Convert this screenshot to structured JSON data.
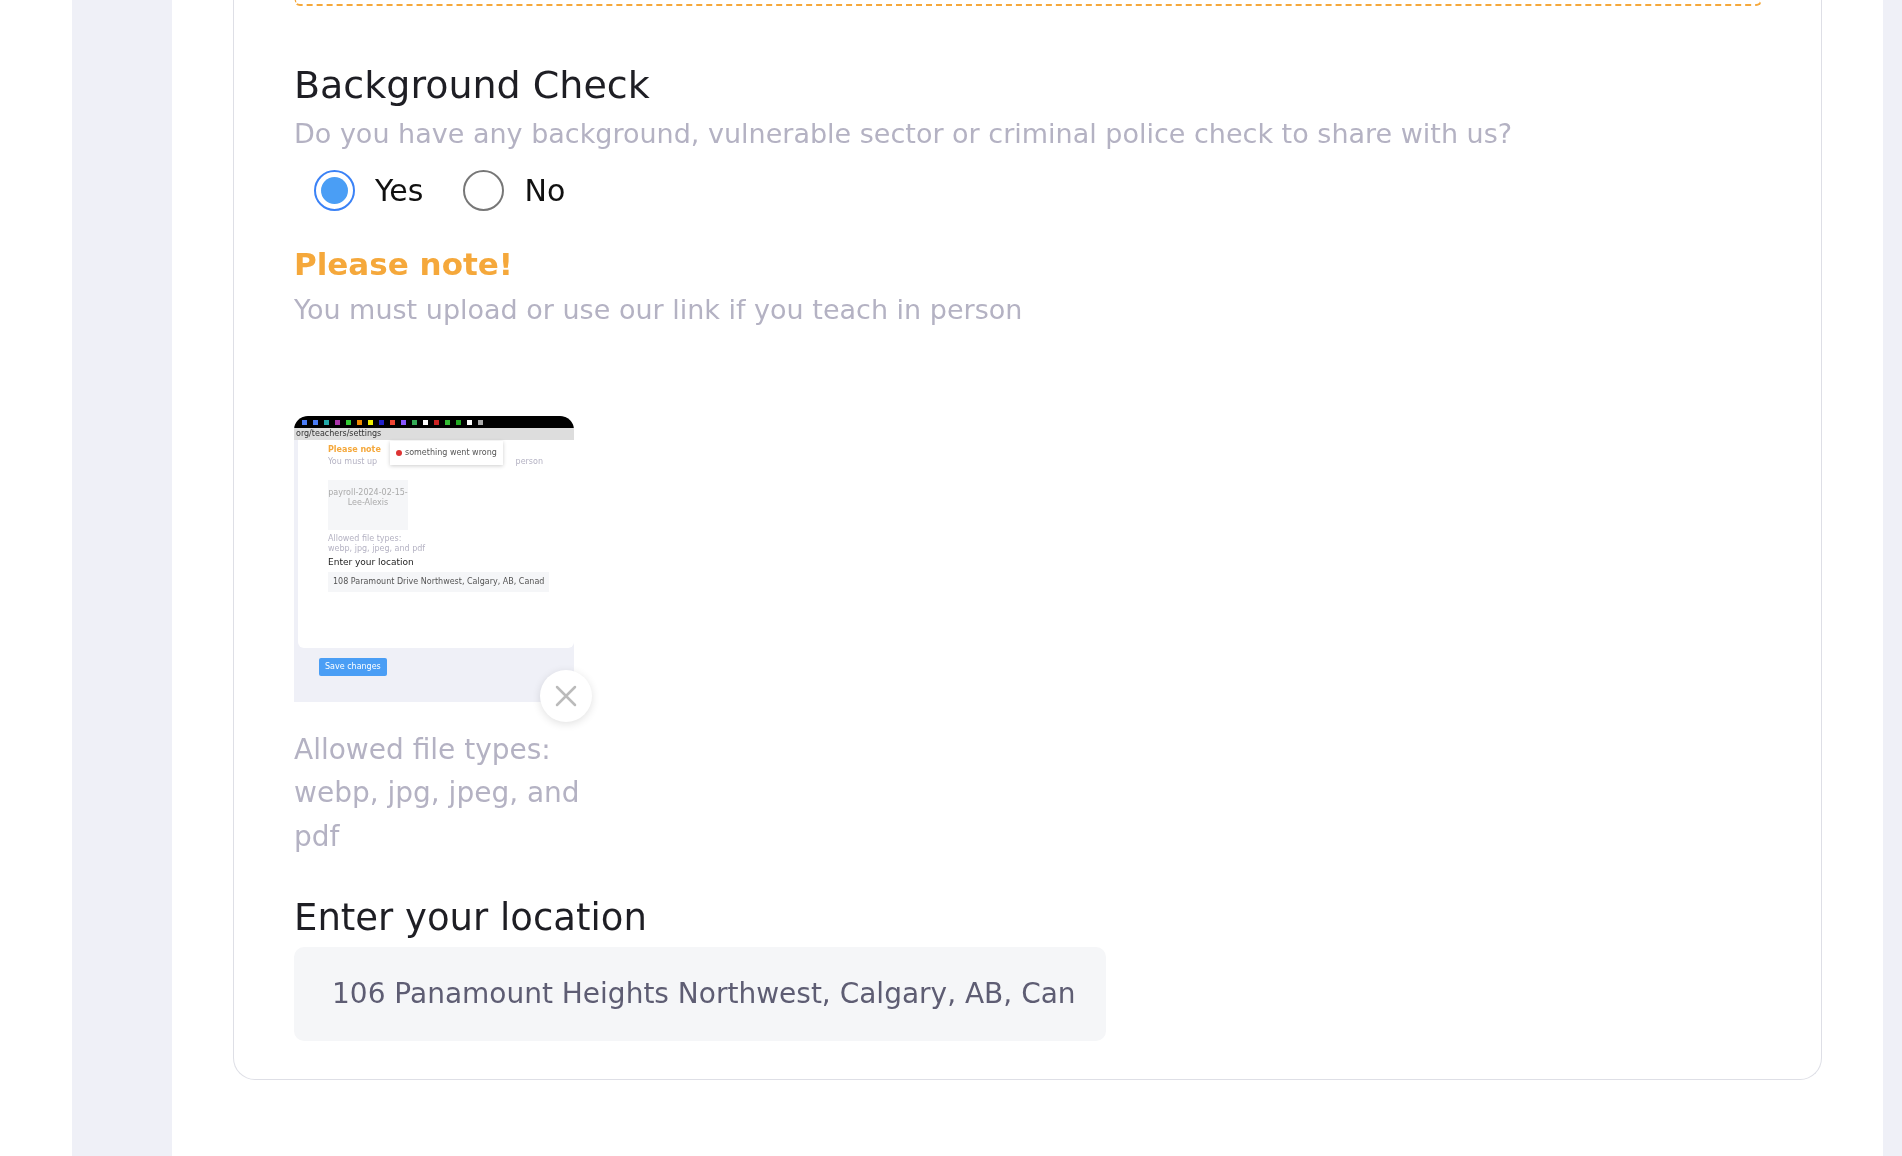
{
  "section": {
    "title": "Background Check",
    "question": "Do you have any background, vulnerable sector or criminal police check to share with us?"
  },
  "options": [
    {
      "label": "Yes",
      "selected": true
    },
    {
      "label": "No",
      "selected": false
    }
  ],
  "note": {
    "title": "Please note!",
    "text": "You must upload or use our link if you teach in person"
  },
  "upload": {
    "preview": {
      "url": "org/teachers/settings",
      "note_title": "Please note",
      "note_text_start": "You must up",
      "note_text_end": "person",
      "toast": "something went wrong",
      "file_name": "payroll-2024-02-15-Lee-Alexis",
      "allowed": "Allowed file types: webp, jpg, jpeg, and pdf",
      "location_label": "Enter your location",
      "location_value": "108 Paramount Drive Northwest, Calgary, AB, Canad",
      "save_button": "Save changes"
    },
    "allowed": "Allowed file types: webp, jpg, jpeg, and pdf"
  },
  "location": {
    "label": "Enter your location",
    "value": "106 Panamount Heights Northwest, Calgary, AB, Can"
  }
}
